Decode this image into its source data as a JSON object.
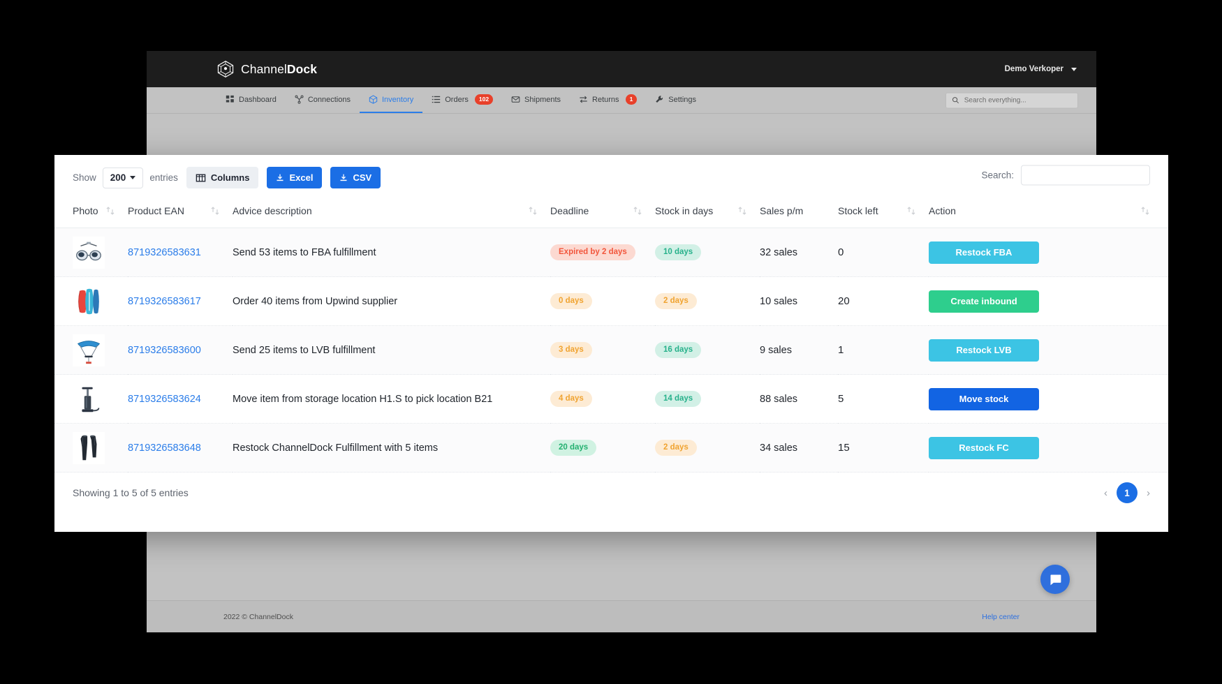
{
  "app": {
    "brand_light": "Channel",
    "brand_bold": "Dock",
    "user": "Demo Verkoper"
  },
  "nav": {
    "items": [
      {
        "label": "Dashboard",
        "icon": "grid-icon",
        "badge": null,
        "active": false
      },
      {
        "label": "Connections",
        "icon": "connections-icon",
        "badge": null,
        "active": false
      },
      {
        "label": "Inventory",
        "icon": "box-icon",
        "badge": null,
        "active": true
      },
      {
        "label": "Orders",
        "icon": "list-icon",
        "badge": "102",
        "active": false
      },
      {
        "label": "Shipments",
        "icon": "shipment-icon",
        "badge": null,
        "active": false
      },
      {
        "label": "Returns",
        "icon": "returns-icon",
        "badge": "1",
        "active": false
      },
      {
        "label": "Settings",
        "icon": "wrench-icon",
        "badge": null,
        "active": false
      }
    ],
    "search_placeholder": "Search everything...",
    "search_value": ""
  },
  "toolbar": {
    "show_label": "Show",
    "entries_label": "entries",
    "page_length": "200",
    "columns_label": "Columns",
    "excel_label": "Excel",
    "csv_label": "CSV",
    "search_label": "Search:",
    "search_value": "",
    "search_placeholder": ""
  },
  "table": {
    "headers": [
      {
        "label": "Photo",
        "sortable": true
      },
      {
        "label": "Product EAN",
        "sortable": true
      },
      {
        "label": "Advice description",
        "sortable": true
      },
      {
        "label": "Deadline",
        "sortable": true
      },
      {
        "label": "Stock in days",
        "sortable": true
      },
      {
        "label": "Sales p/m",
        "sortable": false
      },
      {
        "label": "Stock left",
        "sortable": true
      },
      {
        "label": "Action",
        "sortable": true
      }
    ],
    "rows": [
      {
        "photo": "sunglasses-photo",
        "ean": "8719326583631",
        "advice": "Send 53 items to FBA fulfillment",
        "deadline": "Expired by 2 days",
        "deadline_style": "red",
        "stock_days": "10 days",
        "stock_days_style": "teal",
        "sales": "32 sales",
        "stock_left": "0",
        "action": "Restock FBA",
        "action_style": "cyan"
      },
      {
        "photo": "paddleboard-photo",
        "ean": "8719326583617",
        "advice": "Order 40 items from Upwind supplier",
        "deadline": "0 days",
        "deadline_style": "amber",
        "stock_days": "2 days",
        "stock_days_style": "amber",
        "sales": "10 sales",
        "stock_left": "20",
        "action": "Create inbound",
        "action_style": "green"
      },
      {
        "photo": "kite-photo",
        "ean": "8719326583600",
        "advice": "Send 25 items to LVB fulfillment",
        "deadline": "3 days",
        "deadline_style": "amber",
        "stock_days": "16 days",
        "stock_days_style": "teal",
        "sales": "9 sales",
        "stock_left": "1",
        "action": "Restock LVB",
        "action_style": "cyan"
      },
      {
        "photo": "pump-photo",
        "ean": "8719326583624",
        "advice": "Move item from storage location H1.S to pick location B21",
        "deadline": "4 days",
        "deadline_style": "amber",
        "stock_days": "14 days",
        "stock_days_style": "teal",
        "sales": "88 sales",
        "stock_left": "5",
        "action": "Move stock",
        "action_style": "blue"
      },
      {
        "photo": "wetsuit-photo",
        "ean": "8719326583648",
        "advice": "Restock ChannelDock Fulfillment with 5 items",
        "deadline": "20 days",
        "deadline_style": "green",
        "stock_days": "2 days",
        "stock_days_style": "amber",
        "sales": "34 sales",
        "stock_left": "15",
        "action": "Restock FC",
        "action_style": "cyan"
      }
    ]
  },
  "panel_footer": {
    "showing": "Showing 1 to 5 of 5 entries",
    "prev": "‹",
    "page": "1",
    "next": "›"
  },
  "page_footer": {
    "copyright": "2022 © ChannelDock",
    "help": "Help center"
  },
  "colors": {
    "accent_blue": "#1b6ee5",
    "link_blue": "#2b7de9",
    "cyan": "#3cc4e4",
    "green": "#2ece8d",
    "blue": "#1264e3",
    "badge_red": "#e8402a"
  }
}
